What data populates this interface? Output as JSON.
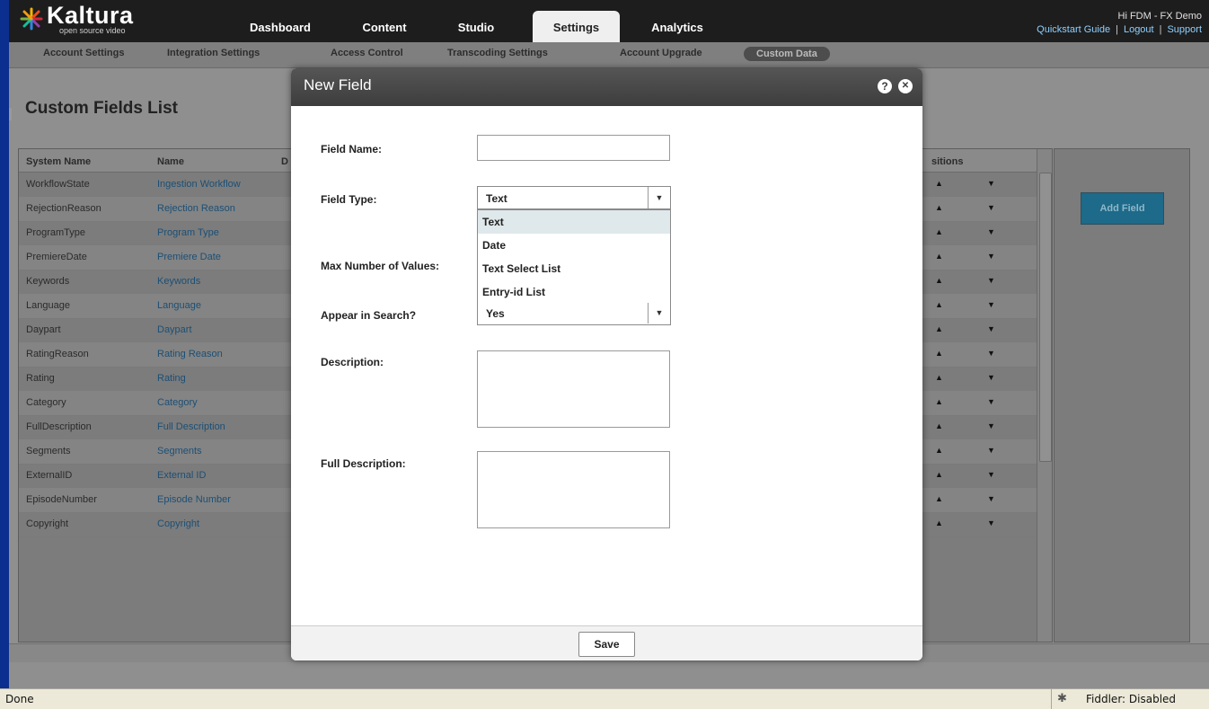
{
  "header": {
    "logo_word": "Kaltura",
    "logo_tagline": "open source video",
    "tabs": [
      {
        "label": "Dashboard"
      },
      {
        "label": "Content"
      },
      {
        "label": "Studio"
      },
      {
        "label": "Settings"
      },
      {
        "label": "Analytics"
      }
    ],
    "active_tab": "Settings",
    "greeting": "Hi FDM - FX Demo",
    "links": [
      "Quickstart Guide",
      "Logout",
      "Support"
    ]
  },
  "subnav": {
    "items": [
      {
        "label": "Account Settings"
      },
      {
        "label": "Integration Settings"
      },
      {
        "label": "Access Control"
      },
      {
        "label": "Transcoding Settings"
      },
      {
        "label": "Account Upgrade"
      },
      {
        "label": "Custom Data"
      }
    ],
    "active": "Custom Data"
  },
  "page": {
    "title": "Custom Fields List"
  },
  "grid": {
    "columns": [
      "System Name",
      "Name",
      "D",
      "sitions"
    ],
    "rows": [
      {
        "system_name": "WorkflowState",
        "name": "Ingestion Workflow"
      },
      {
        "system_name": "RejectionReason",
        "name": "Rejection Reason"
      },
      {
        "system_name": "ProgramType",
        "name": "Program Type"
      },
      {
        "system_name": "PremiereDate",
        "name": "Premiere Date"
      },
      {
        "system_name": "Keywords",
        "name": "Keywords"
      },
      {
        "system_name": "Language",
        "name": "Language"
      },
      {
        "system_name": "Daypart",
        "name": "Daypart"
      },
      {
        "system_name": "RatingReason",
        "name": "Rating Reason"
      },
      {
        "system_name": "Rating",
        "name": "Rating"
      },
      {
        "system_name": "Category",
        "name": "Category"
      },
      {
        "system_name": "FullDescription",
        "name": "Full Description"
      },
      {
        "system_name": "Segments",
        "name": "Segments"
      },
      {
        "system_name": "ExternalID",
        "name": "External ID"
      },
      {
        "system_name": "EpisodeNumber",
        "name": "Episode Number"
      },
      {
        "system_name": "Copyright",
        "name": "Copyright"
      }
    ],
    "up_glyph": "▲",
    "down_glyph": "▼"
  },
  "side": {
    "add_field_label": "Add Field"
  },
  "modal": {
    "title": "New Field",
    "help_glyph": "?",
    "close_glyph": "✕",
    "labels": {
      "field_name": "Field Name:",
      "field_type": "Field Type:",
      "max_values": "Max Number of Values:",
      "appear_in_search": "Appear in Search?",
      "description": "Description:",
      "full_description": "Full Description:"
    },
    "field_name_value": "",
    "field_type_value": "Text",
    "field_type_options": [
      "Text",
      "Date",
      "Text Select List",
      "Entry-id List"
    ],
    "appear_in_search_value": "Yes",
    "description_value": "",
    "full_description_value": "",
    "save_label": "Save",
    "dropdown_arrow": "▼"
  },
  "statusbar": {
    "status": "Done",
    "fiddler": "Fiddler: Disabled"
  },
  "colors": {
    "header_bg": "#1d1d1d",
    "modal_title_bg": "#4a4a4a",
    "link_blue": "#1c4f75",
    "add_field_bg": "#1d6a8a"
  }
}
